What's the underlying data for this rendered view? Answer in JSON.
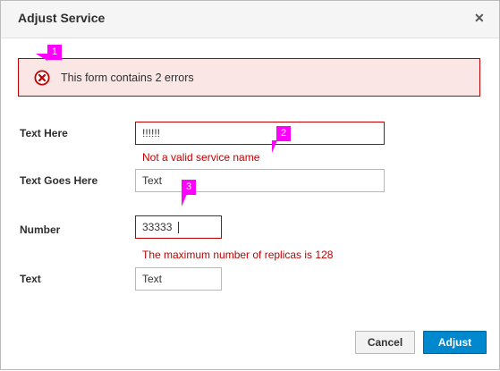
{
  "dialog": {
    "title": "Adjust Service",
    "close_icon": "close-icon"
  },
  "alert": {
    "icon": "error-circle-icon",
    "text": "This form contains 2 errors"
  },
  "form": {
    "text_here": {
      "label": "Text Here",
      "value": "!!!!!!",
      "error": "Not a valid service name"
    },
    "text_goes_here": {
      "label": "Text Goes Here",
      "value": "Text"
    },
    "number": {
      "label": "Number",
      "value": "33333",
      "error": "The maximum number of replicas is 128"
    },
    "text": {
      "label": "Text",
      "value": "Text"
    }
  },
  "buttons": {
    "cancel": "Cancel",
    "adjust": "Adjust"
  },
  "callouts": [
    "1",
    "2",
    "3"
  ],
  "colors": {
    "error": "#c00000",
    "alert_bg": "#fbe6e6",
    "primary": "#0088ce",
    "callout": "#ff00ff"
  }
}
